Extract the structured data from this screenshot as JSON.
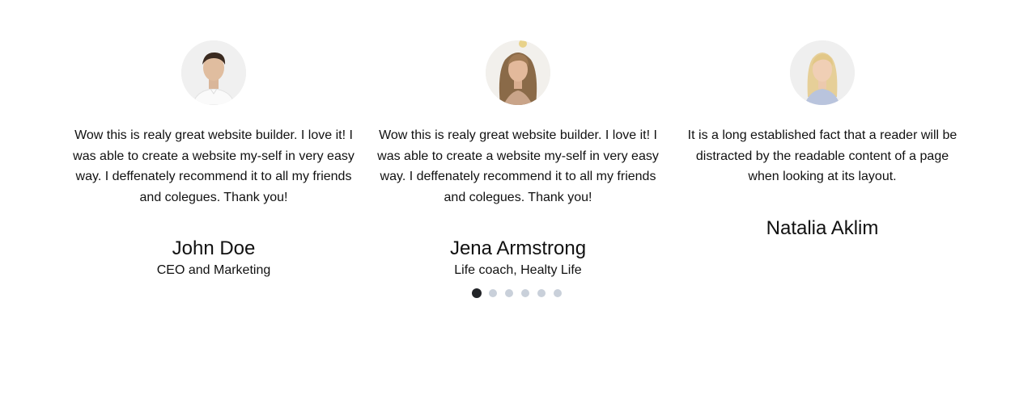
{
  "testimonials": [
    {
      "avatar": "man-portrait-avatar",
      "quote": "Wow this is realy great website builder. I love it! I was able to create a website my-self in very easy way. I deffenately recommend it to all my friends and colegues. Thank you!",
      "name": "John Doe",
      "role": "CEO and Marketing"
    },
    {
      "avatar": "woman-portrait-avatar",
      "quote": "Wow this is realy great website builder. I love it! I was able to create a website my-self in very easy way. I deffenately recommend it to all my friends and colegues. Thank you!",
      "name": "Jena Armstrong",
      "role": "Life coach, Healty Life"
    },
    {
      "avatar": "woman-portrait-avatar",
      "quote": "It is a long established fact that a reader will be distracted by the readable content of a page when looking at its layout.",
      "name": "Natalia Aklim",
      "role": ""
    }
  ],
  "pagination": {
    "count": 6,
    "active_index": 0,
    "active_color": "#222428",
    "inactive_color": "#c9d0da"
  }
}
